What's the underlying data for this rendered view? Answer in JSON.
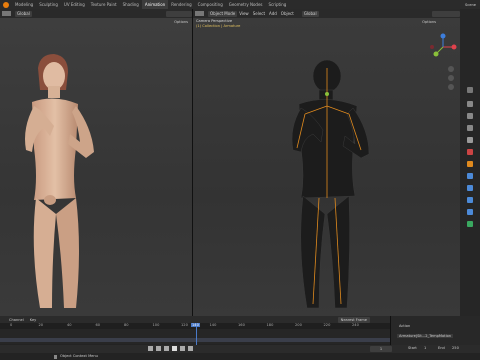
{
  "workspace_tabs": [
    "Modeling",
    "Sculpting",
    "UV Editing",
    "Texture Paint",
    "Shading",
    "Animation",
    "Rendering",
    "Compositing",
    "Geometry Nodes",
    "Scripting"
  ],
  "active_tab": "Animation",
  "scene_label": "Scene",
  "left_view": {
    "transform_label": "Global",
    "options_label": "Options"
  },
  "right_view": {
    "mode_label": "Object Mode",
    "menus": [
      "View",
      "Select",
      "Add",
      "Object"
    ],
    "transform_label": "Global",
    "options_label": "Options",
    "perspective_text": "Camera Perspective",
    "collection_text": "(1) Collection | Armature"
  },
  "timeline": {
    "menus": [
      "Channel",
      "Key"
    ],
    "ruler_ticks": [
      "0",
      "20",
      "40",
      "60",
      "80",
      "100",
      "120",
      "140",
      "160",
      "180",
      "200",
      "220",
      "240"
    ],
    "current_frame": "140",
    "interpolation_label": "Nearest Frame"
  },
  "action_panel": {
    "header": "Action",
    "action_name": "Armature|Sit...2_TempMotion"
  },
  "playback": {
    "frame_current": "1",
    "start_label": "Start",
    "start_value": "1",
    "end_label": "End",
    "end_value": "250"
  },
  "status_bar": {
    "left_text": "Object Context Menu"
  },
  "colors": {
    "accent": "#4772b3",
    "skin": "#d9b59a",
    "bone": "#e08a1e",
    "x_axis": "#e0424c",
    "y_axis": "#8ac03a",
    "z_axis": "#3d7edc"
  }
}
